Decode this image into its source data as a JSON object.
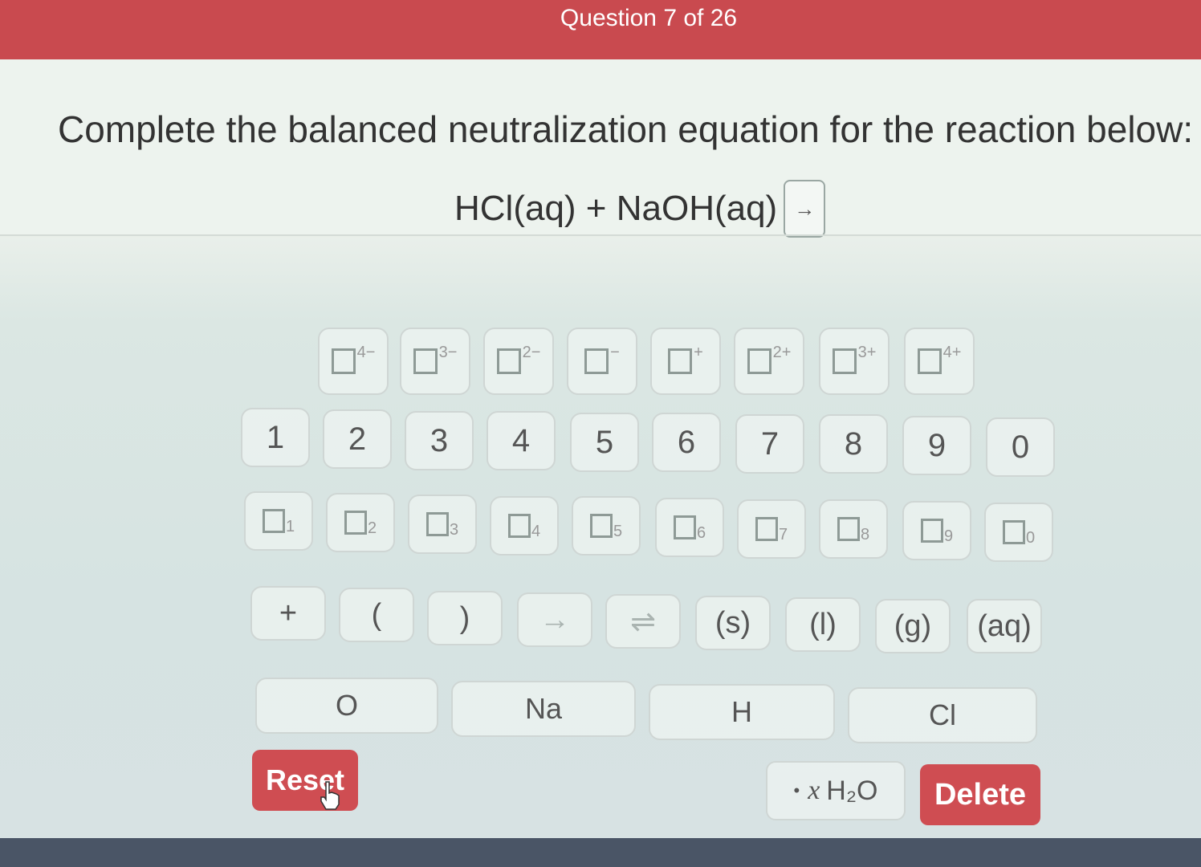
{
  "header": {
    "title": "Question 7 of 26"
  },
  "question": {
    "prompt": "Complete the balanced neutralization equation for the reaction below:",
    "equation": "HCl(aq) + NaOH(aq)",
    "arrow": "→"
  },
  "keypad": {
    "charge_superscripts": [
      "4−",
      "3−",
      "2−",
      "−",
      "+",
      "2+",
      "3+",
      "4+"
    ],
    "numbers": [
      "1",
      "2",
      "3",
      "4",
      "5",
      "6",
      "7",
      "8",
      "9",
      "0"
    ],
    "subscripts": [
      "1",
      "2",
      "3",
      "4",
      "5",
      "6",
      "7",
      "8",
      "9",
      "0"
    ],
    "symbols": {
      "plus": "+",
      "open_paren": "(",
      "close_paren": ")",
      "arrow": "→",
      "equilibrium": "⇌",
      "solid": "(s)",
      "liquid": "(l)",
      "gas": "(g)",
      "aqueous": "(aq)"
    },
    "elements": [
      "O",
      "Na",
      "H",
      "Cl"
    ],
    "hydrate": {
      "dot": "•",
      "x": "x",
      "formula": "H₂O"
    },
    "reset_label": "Reset",
    "delete_label": "Delete"
  },
  "colors": {
    "header": "#c94a4f",
    "button_red": "#cf4d52"
  }
}
